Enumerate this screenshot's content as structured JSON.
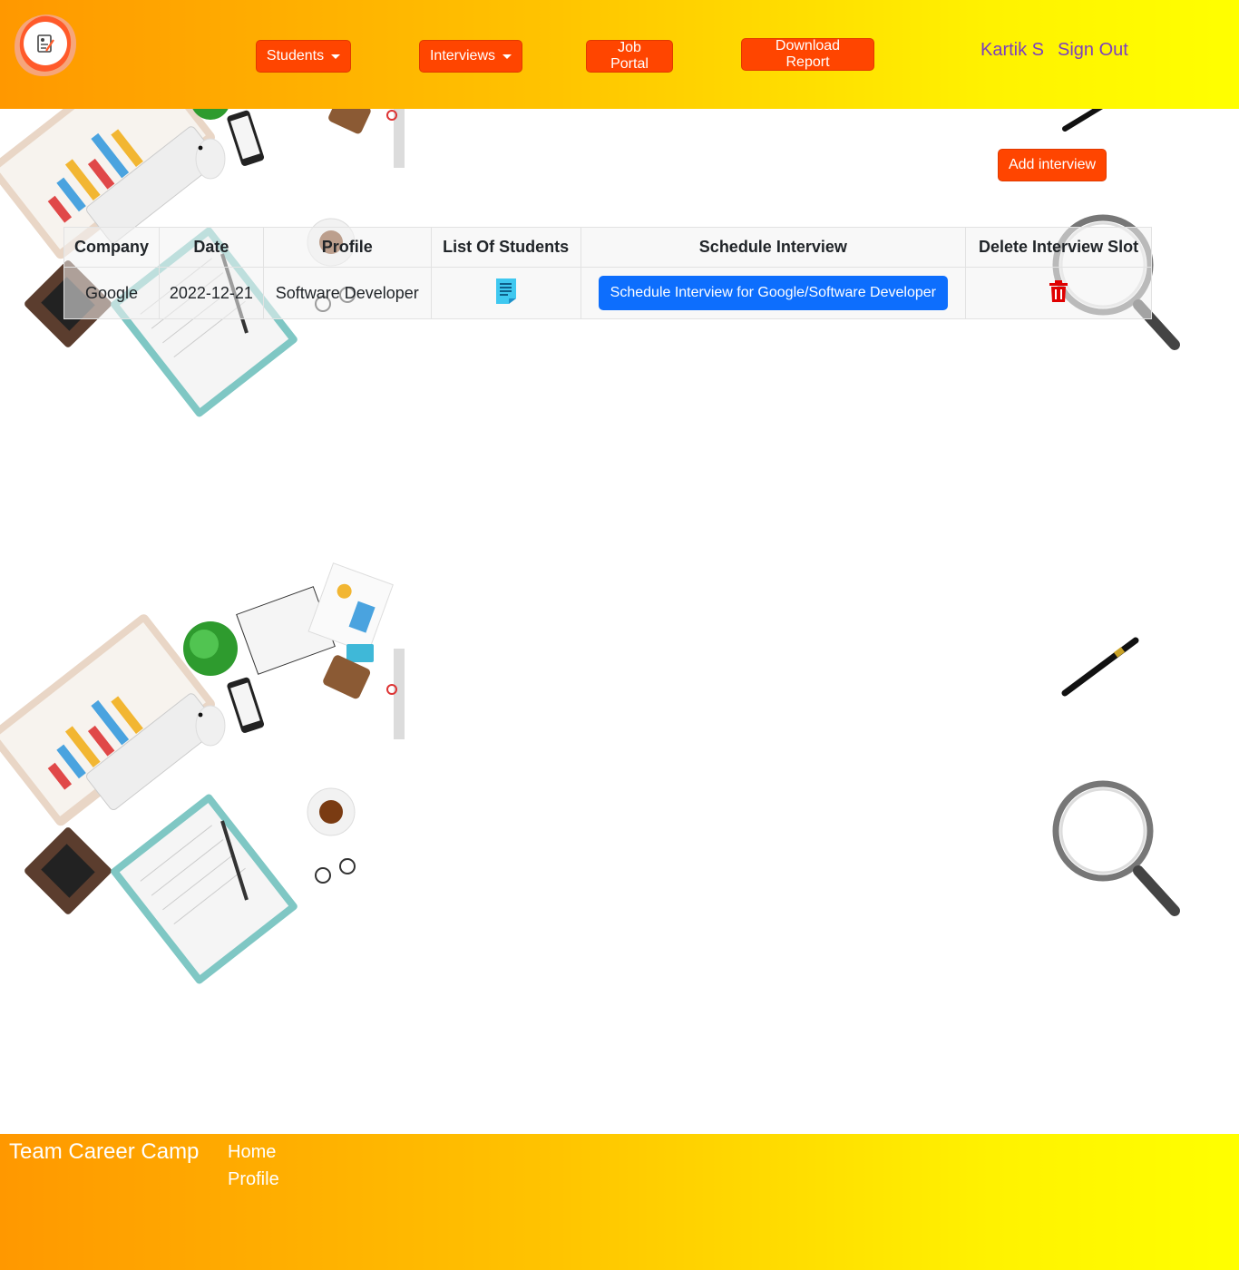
{
  "header": {
    "logo_icon": "resume-logo-icon",
    "nav": {
      "students_label": "Students",
      "interviews_label": "Interviews",
      "job_portal_label": "Job Portal",
      "download_report_label": "Download Report"
    },
    "user": {
      "name": "Kartik S",
      "signout_label": "Sign Out"
    }
  },
  "main": {
    "add_interview_label": "Add interview",
    "table": {
      "columns": [
        "Company",
        "Date",
        "Profile",
        "List Of Students",
        "Schedule Interview",
        "Delete Interview Slot"
      ],
      "rows": [
        {
          "company": "Google",
          "date": "2022-12-21",
          "profile": "Software Developer",
          "list_icon": "document-list-icon",
          "schedule_label": "Schedule Interview for Google/Software Developer",
          "delete_icon": "trash-icon"
        }
      ]
    }
  },
  "footer": {
    "brand": "Team Career Camp",
    "links": [
      "Home",
      "Profile"
    ]
  },
  "colors": {
    "header_gradient_start": "#ff9800",
    "header_gradient_end": "#ffff00",
    "nav_button": "#ff4500",
    "primary_button": "#0d6efd",
    "user_link": "#7b3fbf",
    "delete_icon": "#e00000",
    "list_icon": "#3fc8f0"
  }
}
